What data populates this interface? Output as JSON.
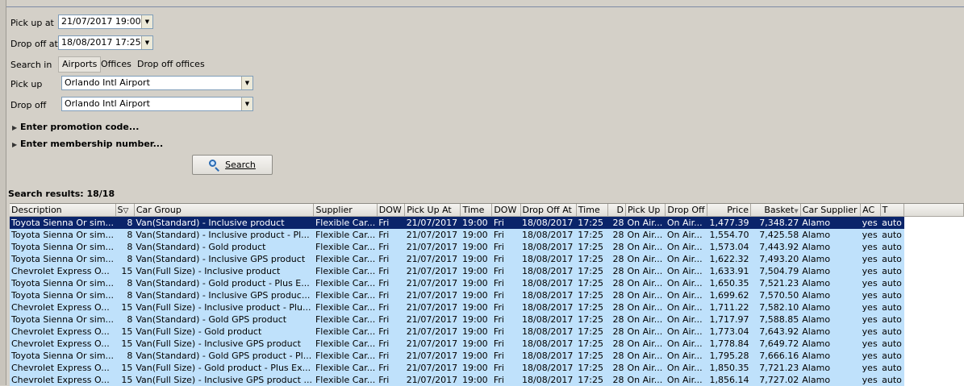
{
  "form": {
    "pickup_at_label": "Pick up at",
    "pickup_at_value": "21/07/2017 19:00",
    "dropoff_at_label": "Drop off at",
    "dropoff_at_value": "18/08/2017 17:25",
    "search_in_label": "Search in",
    "search_in_options": [
      "Airports",
      "Offices",
      "Drop off offices"
    ],
    "search_in_selected": "Airports",
    "pickup_label": "Pick up",
    "pickup_value": "Orlando Intl Airport",
    "dropoff_label": "Drop off",
    "dropoff_value": "Orlando Intl Airport",
    "promo_label": "Enter promotion code...",
    "membership_label": "Enter membership number...",
    "search_button": "Search"
  },
  "results": {
    "title": "Search results: 18/18",
    "columns": [
      "Description",
      "S",
      "Car Group",
      "Supplier",
      "DOW",
      "Pick Up At",
      "Time",
      "DOW",
      "Drop Off At",
      "Time",
      "D",
      "Pick Up",
      "Drop Off",
      "Price",
      "Basket",
      "Car Supplier",
      "AC",
      "T"
    ],
    "rows": [
      [
        "Toyota Sienna Or sim...",
        "8",
        "Van(Standard) - Inclusive product",
        "Flexible Car...",
        "Fri",
        "21/07/2017",
        "19:00",
        "Fri",
        "18/08/2017",
        "17:25",
        "28",
        "On Air...",
        "On Air...",
        "1,477.39",
        "7,348.27",
        "Alamo",
        "yes",
        "auto"
      ],
      [
        "Toyota Sienna Or sim...",
        "8",
        "Van(Standard) - Inclusive product - Pl...",
        "Flexible Car...",
        "Fri",
        "21/07/2017",
        "19:00",
        "Fri",
        "18/08/2017",
        "17:25",
        "28",
        "On Air...",
        "On Air...",
        "1,554.70",
        "7,425.58",
        "Alamo",
        "yes",
        "auto"
      ],
      [
        "Toyota Sienna Or sim...",
        "8",
        "Van(Standard) - Gold product",
        "Flexible Car...",
        "Fri",
        "21/07/2017",
        "19:00",
        "Fri",
        "18/08/2017",
        "17:25",
        "28",
        "On Air...",
        "On Air...",
        "1,573.04",
        "7,443.92",
        "Alamo",
        "yes",
        "auto"
      ],
      [
        "Toyota Sienna Or sim...",
        "8",
        "Van(Standard) - Inclusive GPS product",
        "Flexible Car...",
        "Fri",
        "21/07/2017",
        "19:00",
        "Fri",
        "18/08/2017",
        "17:25",
        "28",
        "On Air...",
        "On Air...",
        "1,622.32",
        "7,493.20",
        "Alamo",
        "yes",
        "auto"
      ],
      [
        "Chevrolet Express O...",
        "15",
        "Van(Full Size) - Inclusive product",
        "Flexible Car...",
        "Fri",
        "21/07/2017",
        "19:00",
        "Fri",
        "18/08/2017",
        "17:25",
        "28",
        "On Air...",
        "On Air...",
        "1,633.91",
        "7,504.79",
        "Alamo",
        "yes",
        "auto"
      ],
      [
        "Toyota Sienna Or sim...",
        "8",
        "Van(Standard) - Gold product - Plus E...",
        "Flexible Car...",
        "Fri",
        "21/07/2017",
        "19:00",
        "Fri",
        "18/08/2017",
        "17:25",
        "28",
        "On Air...",
        "On Air...",
        "1,650.35",
        "7,521.23",
        "Alamo",
        "yes",
        "auto"
      ],
      [
        "Toyota Sienna Or sim...",
        "8",
        "Van(Standard) - Inclusive GPS produc...",
        "Flexible Car...",
        "Fri",
        "21/07/2017",
        "19:00",
        "Fri",
        "18/08/2017",
        "17:25",
        "28",
        "On Air...",
        "On Air...",
        "1,699.62",
        "7,570.50",
        "Alamo",
        "yes",
        "auto"
      ],
      [
        "Chevrolet Express O...",
        "15",
        "Van(Full Size) - Inclusive product - Plu...",
        "Flexible Car...",
        "Fri",
        "21/07/2017",
        "19:00",
        "Fri",
        "18/08/2017",
        "17:25",
        "28",
        "On Air...",
        "On Air...",
        "1,711.22",
        "7,582.10",
        "Alamo",
        "yes",
        "auto"
      ],
      [
        "Toyota Sienna Or sim...",
        "8",
        "Van(Standard) - Gold GPS product",
        "Flexible Car...",
        "Fri",
        "21/07/2017",
        "19:00",
        "Fri",
        "18/08/2017",
        "17:25",
        "28",
        "On Air...",
        "On Air...",
        "1,717.97",
        "7,588.85",
        "Alamo",
        "yes",
        "auto"
      ],
      [
        "Chevrolet Express O...",
        "15",
        "Van(Full Size) - Gold product",
        "Flexible Car...",
        "Fri",
        "21/07/2017",
        "19:00",
        "Fri",
        "18/08/2017",
        "17:25",
        "28",
        "On Air...",
        "On Air...",
        "1,773.04",
        "7,643.92",
        "Alamo",
        "yes",
        "auto"
      ],
      [
        "Chevrolet Express O...",
        "15",
        "Van(Full Size) - Inclusive GPS product",
        "Flexible Car...",
        "Fri",
        "21/07/2017",
        "19:00",
        "Fri",
        "18/08/2017",
        "17:25",
        "28",
        "On Air...",
        "On Air...",
        "1,778.84",
        "7,649.72",
        "Alamo",
        "yes",
        "auto"
      ],
      [
        "Toyota Sienna Or sim...",
        "8",
        "Van(Standard) - Gold GPS product - Pl...",
        "Flexible Car...",
        "Fri",
        "21/07/2017",
        "19:00",
        "Fri",
        "18/08/2017",
        "17:25",
        "28",
        "On Air...",
        "On Air...",
        "1,795.28",
        "7,666.16",
        "Alamo",
        "yes",
        "auto"
      ],
      [
        "Chevrolet Express O...",
        "15",
        "Van(Full Size) - Gold product - Plus Ex...",
        "Flexible Car...",
        "Fri",
        "21/07/2017",
        "19:00",
        "Fri",
        "18/08/2017",
        "17:25",
        "28",
        "On Air...",
        "On Air...",
        "1,850.35",
        "7,721.23",
        "Alamo",
        "yes",
        "auto"
      ],
      [
        "Chevrolet Express O...",
        "15",
        "Van(Full Size) - Inclusive GPS product ...",
        "Flexible Car...",
        "Fri",
        "21/07/2017",
        "19:00",
        "Fri",
        "18/08/2017",
        "17:25",
        "28",
        "On Air...",
        "On Air...",
        "1,856.14",
        "7,727.02",
        "Alamo",
        "yes",
        "auto"
      ]
    ],
    "selected_row": 0
  }
}
